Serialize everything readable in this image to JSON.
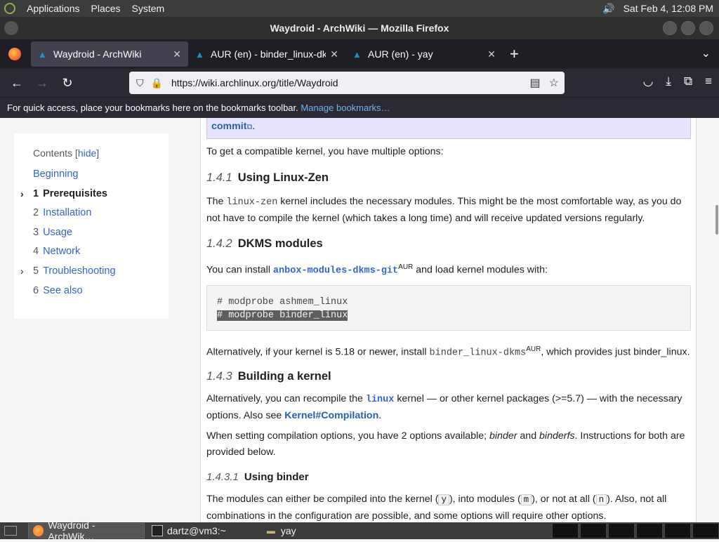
{
  "top_panel": {
    "menus": [
      "Applications",
      "Places",
      "System"
    ],
    "clock": "Sat Feb  4, 12:08 PM"
  },
  "window": {
    "title": "Waydroid - ArchWiki — Mozilla Firefox"
  },
  "tabs": [
    {
      "label": "Waydroid - ArchWiki",
      "active": true
    },
    {
      "label": "AUR (en) - binder_linux-dkms",
      "active": false
    },
    {
      "label": "AUR (en) - yay",
      "active": false
    }
  ],
  "url": "https://wiki.archlinux.org/title/Waydroid",
  "bookmarks_bar": {
    "text": "For quick access, place your bookmarks here on the bookmarks toolbar.",
    "link": "Manage bookmarks…"
  },
  "toc": {
    "title": "Contents",
    "hide": "hide",
    "items": [
      {
        "num": "",
        "label": "Beginning",
        "bold": false,
        "chevron": false
      },
      {
        "num": "1",
        "label": "Prerequisites",
        "bold": true,
        "chevron": true
      },
      {
        "num": "2",
        "label": "Installation",
        "bold": false,
        "chevron": false
      },
      {
        "num": "3",
        "label": "Usage",
        "bold": false,
        "chevron": false
      },
      {
        "num": "4",
        "label": "Network",
        "bold": false,
        "chevron": false
      },
      {
        "num": "5",
        "label": "Troubleshooting",
        "bold": false,
        "chevron": true
      },
      {
        "num": "6",
        "label": "See also",
        "bold": false,
        "chevron": false
      }
    ]
  },
  "article": {
    "note_link": "commit",
    "intro": "To get a compatible kernel, you have multiple options:",
    "s141_num": "1.4.1",
    "s141_title": "Using Linux-Zen",
    "s141_p_pre": "The ",
    "s141_code": "linux-zen",
    "s141_p_post": " kernel includes the necessary modules. This might be the most comfortable way, as you do not have to compile the kernel (which takes a long time) and will receive updated versions regularly.",
    "s142_num": "1.4.2",
    "s142_title": "DKMS modules",
    "s142_p_pre": "You can install ",
    "s142_pkg": "anbox-modules-dkms-git",
    "s142_sup": "AUR",
    "s142_p_post": " and load kernel modules with:",
    "code_line1": "# modprobe ashmem_linux",
    "code_line2": "# modprobe binder_linux",
    "alt_pre": "Alternatively, if your kernel is 5.18 or newer, install ",
    "alt_pkg": "binder_linux-dkms",
    "alt_sup": "AUR",
    "alt_post": ", which provides just binder_linux.",
    "s143_num": "1.4.3",
    "s143_title": "Building a kernel",
    "s143_p1_pre": "Alternatively, you can recompile the ",
    "s143_code": "linux",
    "s143_p1_post": " kernel — or other kernel packages (>=5.7) — with the necessary options. Also see ",
    "s143_link": "Kernel#Compilation",
    "s143_p1_end": ".",
    "s143_p2_pre": "When setting compilation options, you have 2 options available; ",
    "s143_p2_b1": "binder",
    "s143_p2_mid": " and ",
    "s143_p2_b2": "binderfs",
    "s143_p2_post": ". Instructions for both are provided below.",
    "s1431_num": "1.4.3.1",
    "s1431_title": "Using binder",
    "s1431_p_a": "The modules can either be compiled into the kernel (",
    "s1431_y": "y",
    "s1431_p_b": "), into modules (",
    "s1431_m": "m",
    "s1431_p_c": "), or not at all (",
    "s1431_n": "n",
    "s1431_p_d": "). Also, not all combinations in the configuration are possible, and some options will require other options."
  },
  "taskbar": {
    "tasks": [
      "Waydroid - ArchWik…",
      "dartz@vm3:~",
      "yay"
    ]
  }
}
